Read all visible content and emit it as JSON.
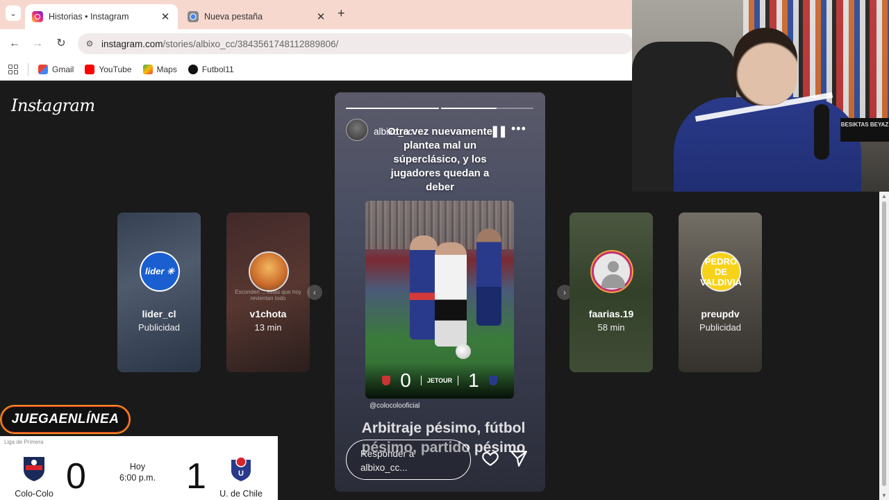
{
  "browser": {
    "tabs": [
      {
        "label": "Historias • Instagram",
        "active": true
      },
      {
        "label": "Nueva pestaña",
        "active": false
      }
    ],
    "url_host": "instagram.com",
    "url_path": "/stories/albixo_cc/3843561748112889806/",
    "bookmarks": [
      {
        "label": "Gmail",
        "icon": "gmail-icon"
      },
      {
        "label": "YouTube",
        "icon": "youtube-icon"
      },
      {
        "label": "Maps",
        "icon": "maps-icon"
      },
      {
        "label": "Futbol11",
        "icon": "futbol11-icon"
      }
    ]
  },
  "instagram": {
    "logo": "Instagram",
    "side_stories": [
      {
        "username": "lider_cl",
        "sub": "Publicidad",
        "avatar_text": "lider ✳"
      },
      {
        "username": "v1chota",
        "sub": "13 min",
        "caption": "Esconden ... listas que hoy revientan todo"
      },
      {
        "username": "faarias.19",
        "sub": "58 min"
      },
      {
        "username": "preupdv",
        "sub": "Publicidad",
        "avatar_text": "PEDRO DE VALDIVIA"
      }
    ],
    "story": {
      "username": "albixo_cc",
      "headline": "Otra vez nuevamente plantea mal un súperclásico, y los jugadores quedan a deber",
      "credit": "@colocolooficial",
      "photo_score_home": "0",
      "photo_score_away": "1",
      "photo_sponsor": "JETOUR",
      "caption": "Arbitraje pésimo, fútbol pésimo, partido pésimo",
      "reply_placeholder": "Responder a albixo_cc...",
      "progress": {
        "segments": 2,
        "current_segment": 2,
        "current_fill": 0.6
      }
    }
  },
  "webcam": {
    "sign": "BESIKTAS BEYAZ"
  },
  "overlay": {
    "sponsor": "JUEGAENLÍNEA",
    "league": "Liga de Primera",
    "home_team": "Colo-Colo",
    "home_goals": "0",
    "away_team": "U. de Chile",
    "away_goals": "1",
    "day": "Hoy",
    "time": "6:00 p.m."
  },
  "colors": {
    "tabbar": "#f7d8cf",
    "instagram_bg": "#1a1a1a",
    "sponsor_border": "#f28c1e",
    "uchile_blue": "#2a3a8a",
    "colocolo_red": "#c33333"
  }
}
